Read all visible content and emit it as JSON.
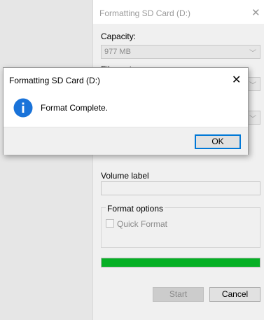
{
  "format_window": {
    "title": "Formatting SD Card (D:)",
    "capacity_label": "Capacity:",
    "capacity_value": "977 MB",
    "file_system_label": "File system",
    "volume_label_label": "Volume label",
    "volume_label_value": "",
    "format_options_label": "Format options",
    "quick_format_label": "Quick Format",
    "progress_percent": 100,
    "start_label": "Start",
    "cancel_label": "Cancel"
  },
  "message_box": {
    "title": "Formatting SD Card (D:)",
    "message": "Format Complete.",
    "ok_label": "OK"
  },
  "colors": {
    "progress": "#06b025",
    "info_icon": "#1a73d9",
    "ok_border": "#0078d7"
  }
}
